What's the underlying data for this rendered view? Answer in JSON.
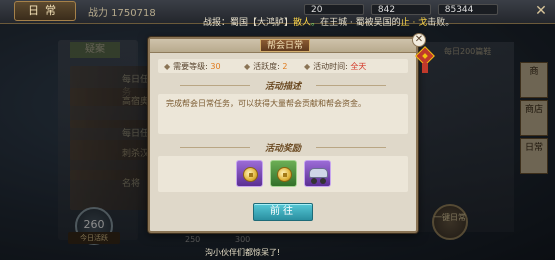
{
  "top": {
    "title": "日常",
    "power": "战力 1750718",
    "notice": {
      "prefix": "战报：",
      "part1": "蜀国【大鸿胪】",
      "name": "散人",
      "sep": "。",
      "part2": "在王城 · 蜀被吴国的",
      "enemy": "止 · 戈",
      "suffix": "击败。"
    },
    "resources": [
      "20",
      "842",
      "85344"
    ],
    "close_glyph": "✕"
  },
  "background": {
    "tab_label": "疑案",
    "list_items": [
      "每日任务",
      "高宿奥",
      "每日任",
      "刺杀汉",
      "名将"
    ],
    "right_tag": "每日200篇鞋",
    "level_value": "260",
    "level_sub": "今日活跃",
    "round_btn": "一键日常",
    "side_buttons": [
      "商",
      "商店",
      "日常"
    ],
    "axis_ticks": [
      "250",
      "300"
    ],
    "chat": "沟小伙伴们都惊呆了!"
  },
  "dialog": {
    "title": "帮会日常",
    "requirements": {
      "level_label": "需要等级:",
      "level_value": "30",
      "activity_label": "活跃度:",
      "activity_value": "2",
      "time_label": "活动时间:",
      "time_value": "全天"
    },
    "desc_header": "活动描述",
    "description": "完成帮会日常任务，可以获得大量帮会贡献和帮会资金。",
    "reward_header": "活动奖励",
    "rewards": [
      {
        "icon": "coin-icon",
        "quality": "purple"
      },
      {
        "icon": "coin-icon",
        "quality": "green"
      },
      {
        "icon": "cart-icon",
        "quality": "purple"
      }
    ],
    "go_label": "前往",
    "close_glyph": "✕"
  }
}
